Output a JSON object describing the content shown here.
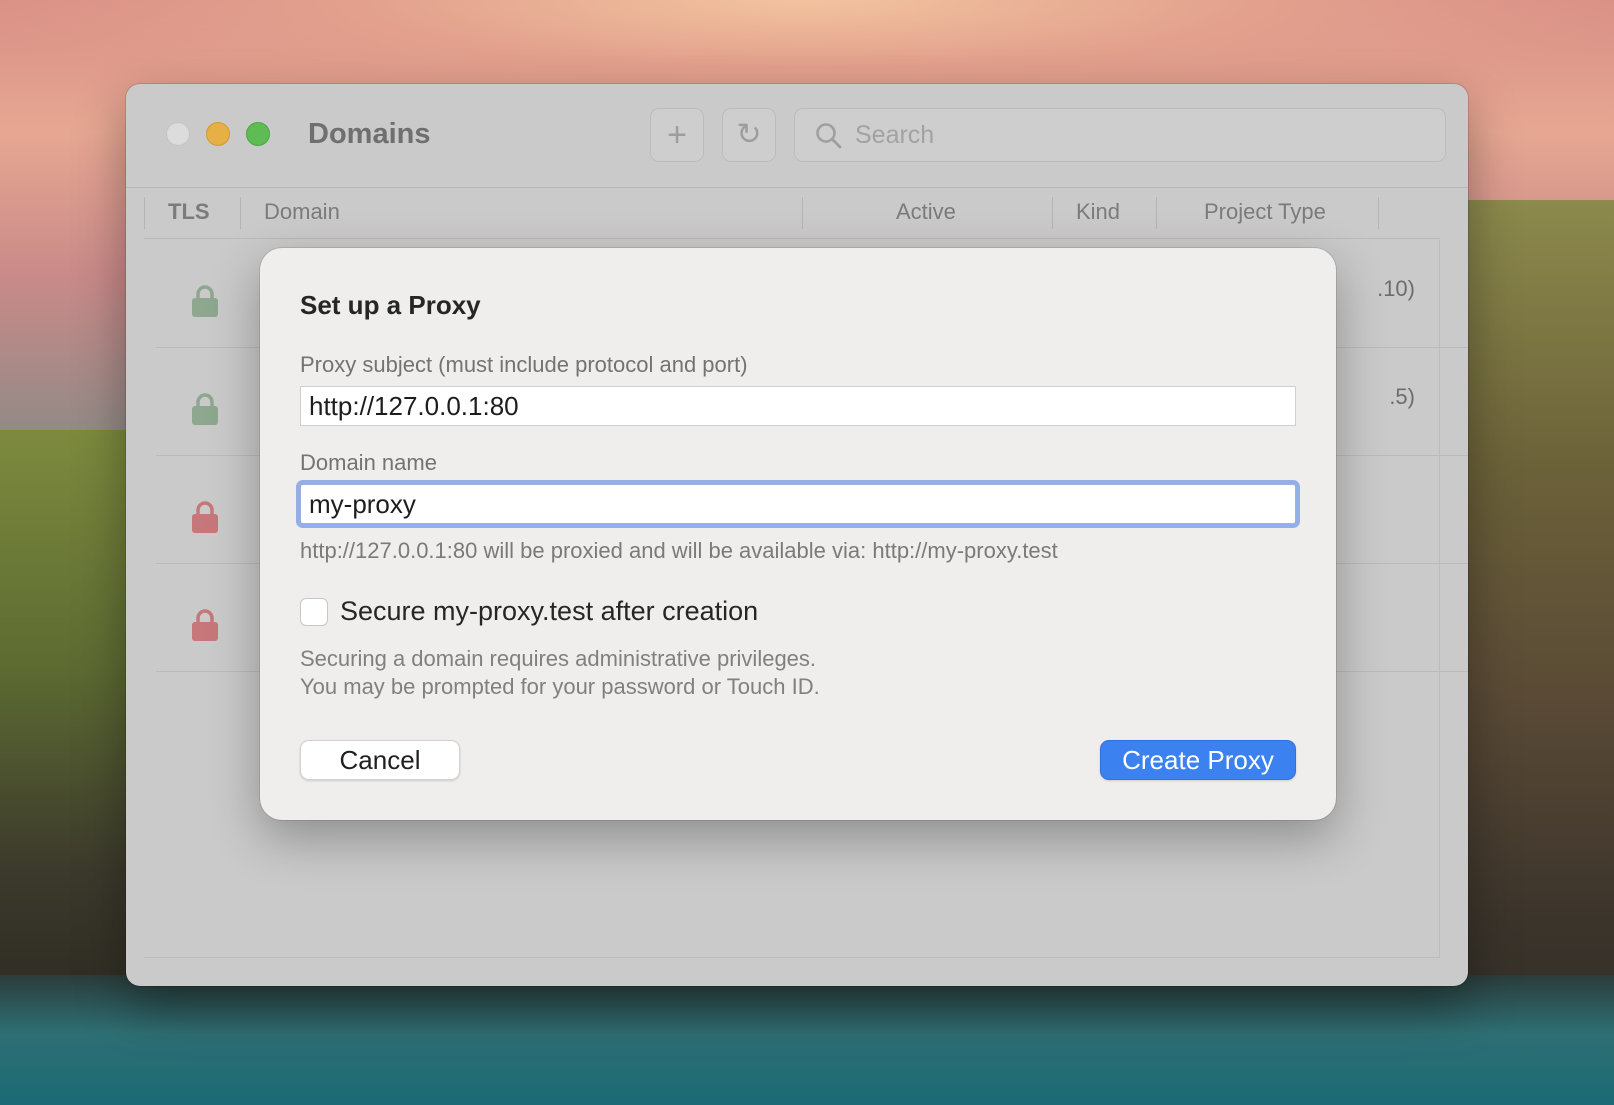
{
  "window": {
    "title": "Domains",
    "search_placeholder": "Search"
  },
  "table": {
    "columns": [
      "TLS",
      "Domain",
      "Active",
      "Kind",
      "Project Type"
    ],
    "rows": [
      {
        "lock_color": "#8ea78f",
        "trailing_text": ".10)"
      },
      {
        "lock_color": "#8ea78f",
        "trailing_text": ".5)"
      },
      {
        "lock_color": "#c7777a",
        "trailing_text": ""
      },
      {
        "lock_color": "#c7777a",
        "trailing_text": ""
      }
    ]
  },
  "dialog": {
    "title": "Set up a Proxy",
    "subject_label": "Proxy subject (must include protocol and port)",
    "subject_value": "http://127.0.0.1:80",
    "domain_label": "Domain name",
    "domain_value": "my-proxy",
    "hint": "http://127.0.0.1:80 will be proxied and will be available via: http://my-proxy.test",
    "secure_label": "Secure my-proxy.test after creation",
    "secure_checked": false,
    "note_line1": "Securing a domain requires administrative privileges.",
    "note_line2": "You may be prompted for your password or Touch ID.",
    "cancel_label": "Cancel",
    "create_label": "Create Proxy"
  },
  "colors": {
    "accent": "#3b82f0",
    "focus_ring": "#93aee8",
    "lock_secure": "#8ea78f",
    "lock_insecure": "#c7777a"
  }
}
